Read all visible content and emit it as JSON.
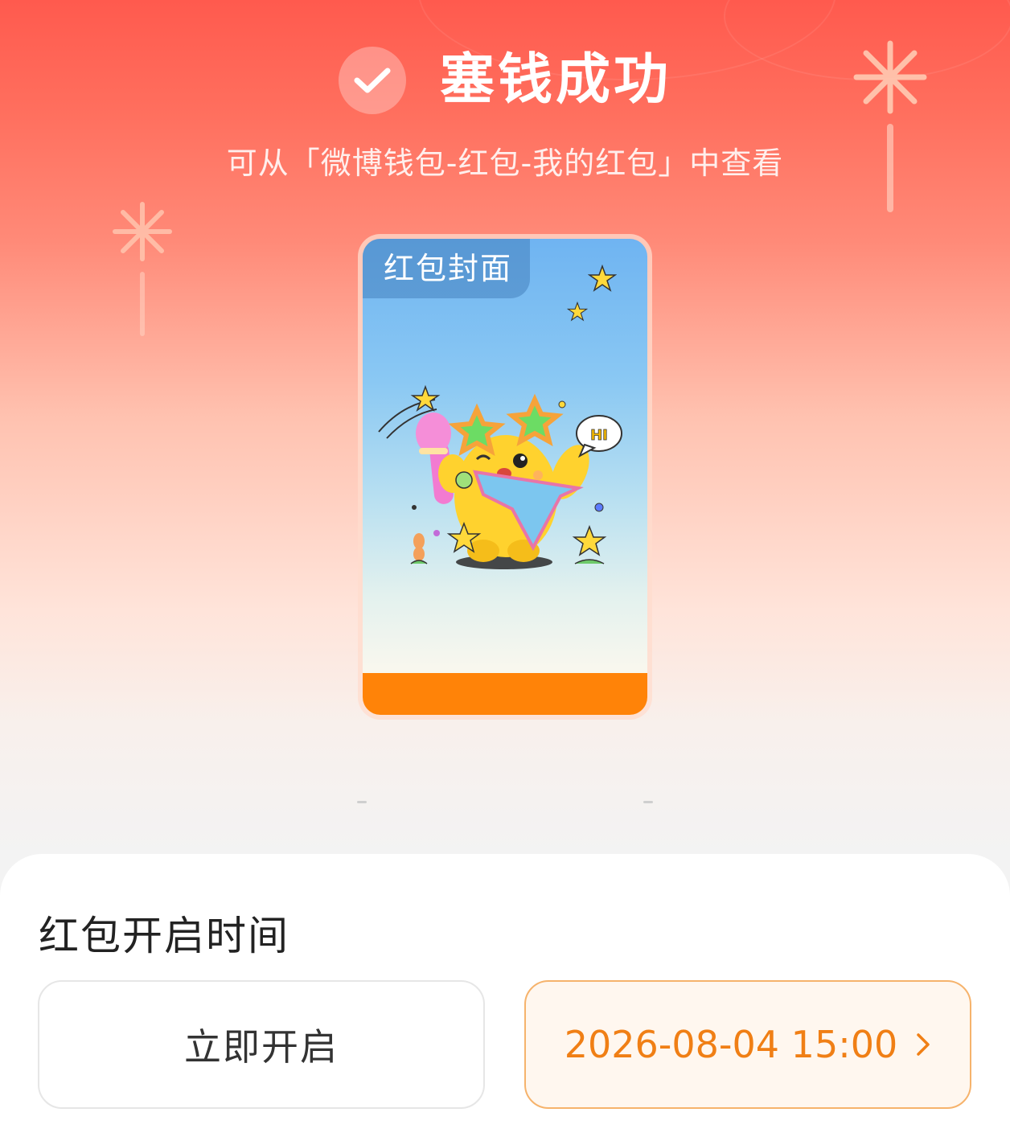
{
  "header": {
    "title": "塞钱成功",
    "subtitle": "可从「微博钱包-红包-我的红包」中查看"
  },
  "cover": {
    "tag_label": "红包封面",
    "speech_bubble_text": "HI",
    "footer_color": "#ff8308"
  },
  "open_time": {
    "section_title": "红包开启时间",
    "option_now_label": "立即开启",
    "option_scheduled_label": "2026-08-04 15:00",
    "selected_option": "scheduled"
  },
  "colors": {
    "accent": "#f07f15",
    "header_red": "#ff5a4e"
  },
  "icons": {
    "success": "check-icon",
    "scheduled_arrow": "chevron-right-icon"
  }
}
